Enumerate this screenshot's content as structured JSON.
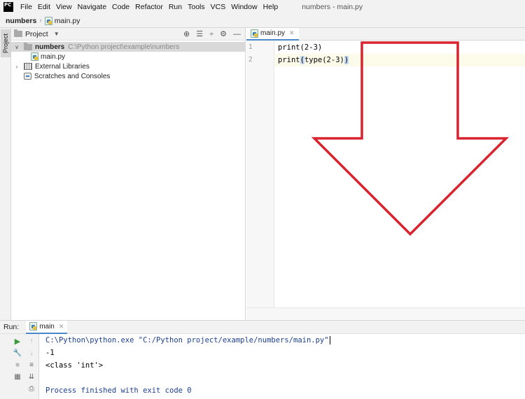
{
  "app": {
    "logo_text": "PC",
    "window_title": "numbers - main.py"
  },
  "menu": [
    "File",
    "Edit",
    "View",
    "Navigate",
    "Code",
    "Refactor",
    "Run",
    "Tools",
    "VCS",
    "Window",
    "Help"
  ],
  "breadcrumb": {
    "project": "numbers",
    "file": "main.py"
  },
  "left_strip": {
    "project_tab": "Project"
  },
  "project_panel": {
    "header_label": "Project",
    "tree": {
      "root_name": "numbers",
      "root_path": "C:\\Python project\\example\\numbers",
      "file_name": "main.py",
      "external_libraries": "External Libraries",
      "scratches": "Scratches and Consoles"
    }
  },
  "editor": {
    "tab_label": "main.py",
    "lines": [
      {
        "num": "1",
        "code": "print(2-3)"
      },
      {
        "num": "2",
        "code_before": "print",
        "code_brace_open": "(",
        "code_middle": "type(2-3)",
        "code_brace_close": ")"
      }
    ]
  },
  "run_panel": {
    "label": "Run:",
    "tab_label": "main",
    "output": [
      "C:\\Python\\python.exe \"C:/Python project/example/numbers/main.py\"",
      "-1",
      "<class 'int'>",
      "",
      "Process finished with exit code 0"
    ]
  },
  "colors": {
    "arrow_outline": "#d9232e",
    "accent": "#4a88c7",
    "console_command": "#1c3f94"
  }
}
